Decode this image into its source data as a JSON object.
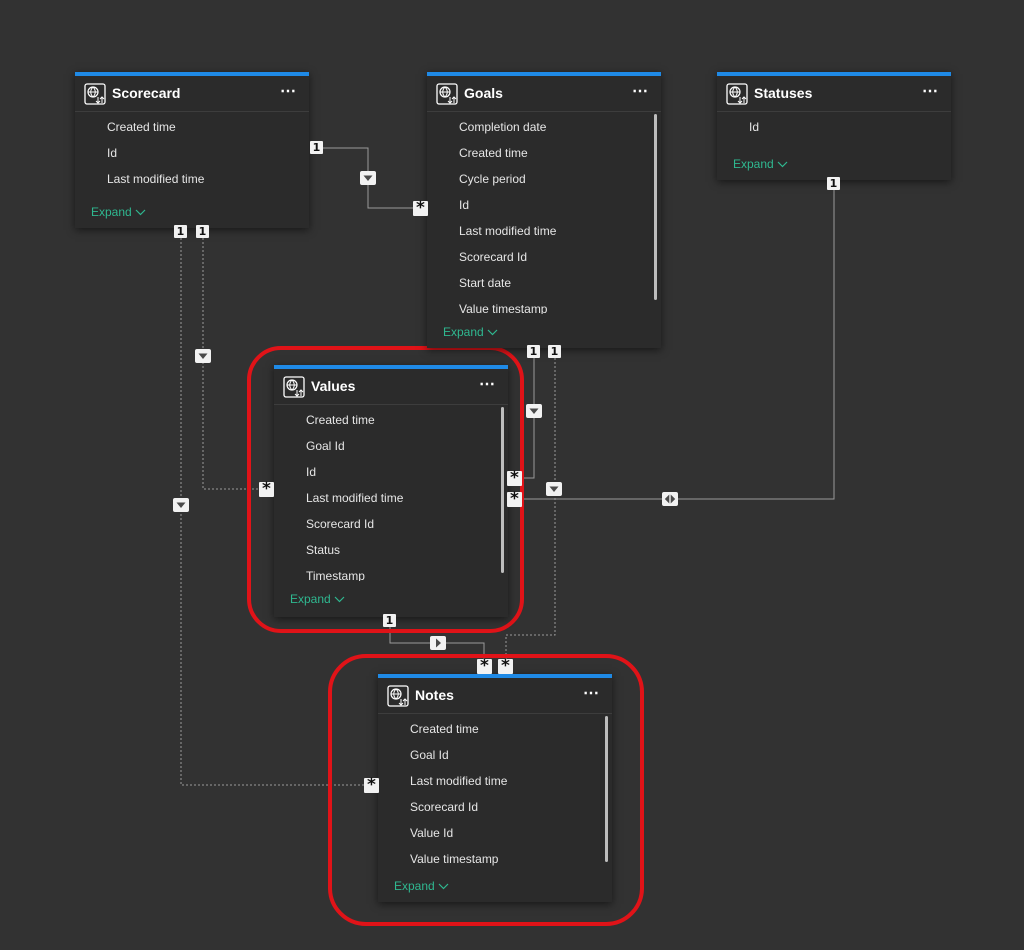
{
  "tables": {
    "scorecard": {
      "title": "Scorecard",
      "fields": [
        "Created time",
        "Id",
        "Last modified time"
      ],
      "expand": "Expand"
    },
    "goals": {
      "title": "Goals",
      "fields": [
        "Completion date",
        "Created time",
        "Cycle period",
        "Id",
        "Last modified time",
        "Scorecard Id",
        "Start date",
        "Value timestamp"
      ],
      "expand": "Expand"
    },
    "statuses": {
      "title": "Statuses",
      "fields": [
        "Id"
      ],
      "expand": "Expand"
    },
    "values": {
      "title": "Values",
      "fields": [
        "Created time",
        "Goal Id",
        "Id",
        "Last modified time",
        "Scorecard Id",
        "Status",
        "Timestamp"
      ],
      "expand": "Expand"
    },
    "notes": {
      "title": "Notes",
      "fields": [
        "Created time",
        "Goal Id",
        "Last modified time",
        "Scorecard Id",
        "Value Id",
        "Value timestamp"
      ],
      "expand": "Expand"
    }
  },
  "cardinality": {
    "one": "1",
    "many": "*"
  },
  "colors": {
    "accent": "#1f8ae6",
    "expand_text": "#2fb890",
    "highlight": "#e01318",
    "canvas": "#323232",
    "card": "#2b2b2b"
  },
  "icons": {
    "table": "globe-refresh-icon",
    "menu": "more-options-icon",
    "expand": "chevron-down-icon"
  }
}
